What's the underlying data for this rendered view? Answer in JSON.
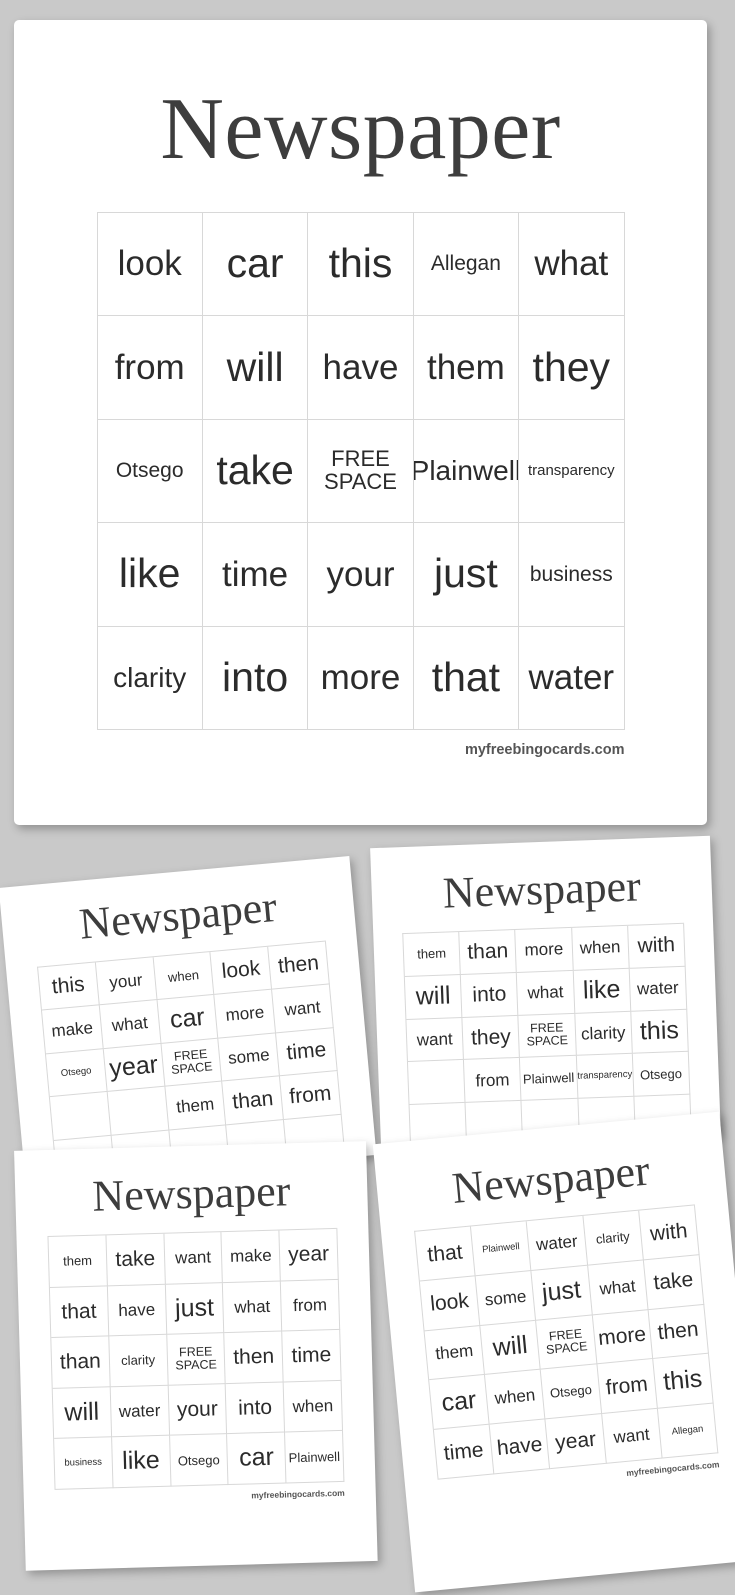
{
  "site": {
    "footer_url": "myfreebingocards.com"
  },
  "cards": [
    {
      "id": "card-main",
      "title": "Newspaper",
      "cells": [
        {
          "text": "look",
          "size": "s-lg"
        },
        {
          "text": "car",
          "size": "s-xl"
        },
        {
          "text": "this",
          "size": "s-xl"
        },
        {
          "text": "Allegan",
          "size": "s-sm"
        },
        {
          "text": "what",
          "size": "s-lg"
        },
        {
          "text": "from",
          "size": "s-lg"
        },
        {
          "text": "will",
          "size": "s-xl"
        },
        {
          "text": "have",
          "size": "s-lg"
        },
        {
          "text": "them",
          "size": "s-lg"
        },
        {
          "text": "they",
          "size": "s-xl"
        },
        {
          "text": "Otsego",
          "size": "s-sm"
        },
        {
          "text": "take",
          "size": "s-xl"
        },
        {
          "text": "FREE\nSPACE",
          "size": "free"
        },
        {
          "text": "Plainwell",
          "size": "s-md"
        },
        {
          "text": "transparency",
          "size": "s-xs"
        },
        {
          "text": "like",
          "size": "s-xl"
        },
        {
          "text": "time",
          "size": "s-lg"
        },
        {
          "text": "your",
          "size": "s-lg"
        },
        {
          "text": "just",
          "size": "s-xl"
        },
        {
          "text": "business",
          "size": "s-sm"
        },
        {
          "text": "clarity",
          "size": "s-md"
        },
        {
          "text": "into",
          "size": "s-xl"
        },
        {
          "text": "more",
          "size": "s-lg"
        },
        {
          "text": "that",
          "size": "s-xl"
        },
        {
          "text": "water",
          "size": "s-lg"
        }
      ]
    },
    {
      "id": "card-2",
      "title": "Newspaper",
      "cells": [
        {
          "text": "this",
          "size": "s-lg"
        },
        {
          "text": "your",
          "size": "s-md"
        },
        {
          "text": "when",
          "size": "s-sm"
        },
        {
          "text": "look",
          "size": "s-lg"
        },
        {
          "text": "then",
          "size": "s-lg"
        },
        {
          "text": "make",
          "size": "s-md"
        },
        {
          "text": "what",
          "size": "s-md"
        },
        {
          "text": "car",
          "size": "s-xl"
        },
        {
          "text": "more",
          "size": "s-md"
        },
        {
          "text": "want",
          "size": "s-md"
        },
        {
          "text": "Otsego",
          "size": "s-xs"
        },
        {
          "text": "year",
          "size": "s-xl"
        },
        {
          "text": "FREE\nSPACE",
          "size": "free"
        },
        {
          "text": "some",
          "size": "s-md"
        },
        {
          "text": "time",
          "size": "s-lg"
        },
        {
          "text": "",
          "size": "s-md"
        },
        {
          "text": "",
          "size": "s-md"
        },
        {
          "text": "them",
          "size": "s-md"
        },
        {
          "text": "than",
          "size": "s-lg"
        },
        {
          "text": "from",
          "size": "s-lg"
        },
        {
          "text": "",
          "size": "s-md"
        },
        {
          "text": "",
          "size": "s-md"
        },
        {
          "text": "",
          "size": "s-md"
        },
        {
          "text": "",
          "size": "s-md"
        },
        {
          "text": "",
          "size": "s-md"
        }
      ]
    },
    {
      "id": "card-3",
      "title": "Newspaper",
      "cells": [
        {
          "text": "them",
          "size": "s-sm"
        },
        {
          "text": "than",
          "size": "s-lg"
        },
        {
          "text": "more",
          "size": "s-md"
        },
        {
          "text": "when",
          "size": "s-md"
        },
        {
          "text": "with",
          "size": "s-lg"
        },
        {
          "text": "will",
          "size": "s-xl"
        },
        {
          "text": "into",
          "size": "s-lg"
        },
        {
          "text": "what",
          "size": "s-md"
        },
        {
          "text": "like",
          "size": "s-xl"
        },
        {
          "text": "water",
          "size": "s-md"
        },
        {
          "text": "want",
          "size": "s-md"
        },
        {
          "text": "they",
          "size": "s-lg"
        },
        {
          "text": "FREE\nSPACE",
          "size": "free"
        },
        {
          "text": "clarity",
          "size": "s-md"
        },
        {
          "text": "this",
          "size": "s-xl"
        },
        {
          "text": "",
          "size": "s-md"
        },
        {
          "text": "from",
          "size": "s-md"
        },
        {
          "text": "Plainwell",
          "size": "s-sm"
        },
        {
          "text": "transparency",
          "size": "s-xs"
        },
        {
          "text": "Otsego",
          "size": "s-sm"
        },
        {
          "text": "",
          "size": "s-md"
        },
        {
          "text": "",
          "size": "s-md"
        },
        {
          "text": "",
          "size": "s-md"
        },
        {
          "text": "",
          "size": "s-md"
        },
        {
          "text": "",
          "size": "s-md"
        }
      ]
    },
    {
      "id": "card-4",
      "title": "Newspaper",
      "cells": [
        {
          "text": "them",
          "size": "s-sm"
        },
        {
          "text": "take",
          "size": "s-lg"
        },
        {
          "text": "want",
          "size": "s-md"
        },
        {
          "text": "make",
          "size": "s-md"
        },
        {
          "text": "year",
          "size": "s-lg"
        },
        {
          "text": "that",
          "size": "s-lg"
        },
        {
          "text": "have",
          "size": "s-md"
        },
        {
          "text": "just",
          "size": "s-xl"
        },
        {
          "text": "what",
          "size": "s-md"
        },
        {
          "text": "from",
          "size": "s-md"
        },
        {
          "text": "than",
          "size": "s-lg"
        },
        {
          "text": "clarity",
          "size": "s-sm"
        },
        {
          "text": "FREE\nSPACE",
          "size": "free"
        },
        {
          "text": "then",
          "size": "s-lg"
        },
        {
          "text": "time",
          "size": "s-lg"
        },
        {
          "text": "will",
          "size": "s-xl"
        },
        {
          "text": "water",
          "size": "s-md"
        },
        {
          "text": "your",
          "size": "s-lg"
        },
        {
          "text": "into",
          "size": "s-lg"
        },
        {
          "text": "when",
          "size": "s-md"
        },
        {
          "text": "business",
          "size": "s-xs"
        },
        {
          "text": "like",
          "size": "s-xl"
        },
        {
          "text": "Otsego",
          "size": "s-sm"
        },
        {
          "text": "car",
          "size": "s-xl"
        },
        {
          "text": "Plainwell",
          "size": "s-sm"
        }
      ]
    },
    {
      "id": "card-5",
      "title": "Newspaper",
      "cells": [
        {
          "text": "that",
          "size": "s-lg"
        },
        {
          "text": "Plainwell",
          "size": "s-xs"
        },
        {
          "text": "water",
          "size": "s-md"
        },
        {
          "text": "clarity",
          "size": "s-sm"
        },
        {
          "text": "with",
          "size": "s-lg"
        },
        {
          "text": "look",
          "size": "s-lg"
        },
        {
          "text": "some",
          "size": "s-md"
        },
        {
          "text": "just",
          "size": "s-xl"
        },
        {
          "text": "what",
          "size": "s-md"
        },
        {
          "text": "take",
          "size": "s-lg"
        },
        {
          "text": "them",
          "size": "s-md"
        },
        {
          "text": "will",
          "size": "s-xl"
        },
        {
          "text": "FREE\nSPACE",
          "size": "free"
        },
        {
          "text": "more",
          "size": "s-lg"
        },
        {
          "text": "then",
          "size": "s-lg"
        },
        {
          "text": "car",
          "size": "s-xl"
        },
        {
          "text": "when",
          "size": "s-md"
        },
        {
          "text": "Otsego",
          "size": "s-sm"
        },
        {
          "text": "from",
          "size": "s-lg"
        },
        {
          "text": "this",
          "size": "s-xl"
        },
        {
          "text": "time",
          "size": "s-lg"
        },
        {
          "text": "have",
          "size": "s-lg"
        },
        {
          "text": "year",
          "size": "s-lg"
        },
        {
          "text": "want",
          "size": "s-md"
        },
        {
          "text": "Allegan",
          "size": "s-xs"
        }
      ]
    }
  ]
}
